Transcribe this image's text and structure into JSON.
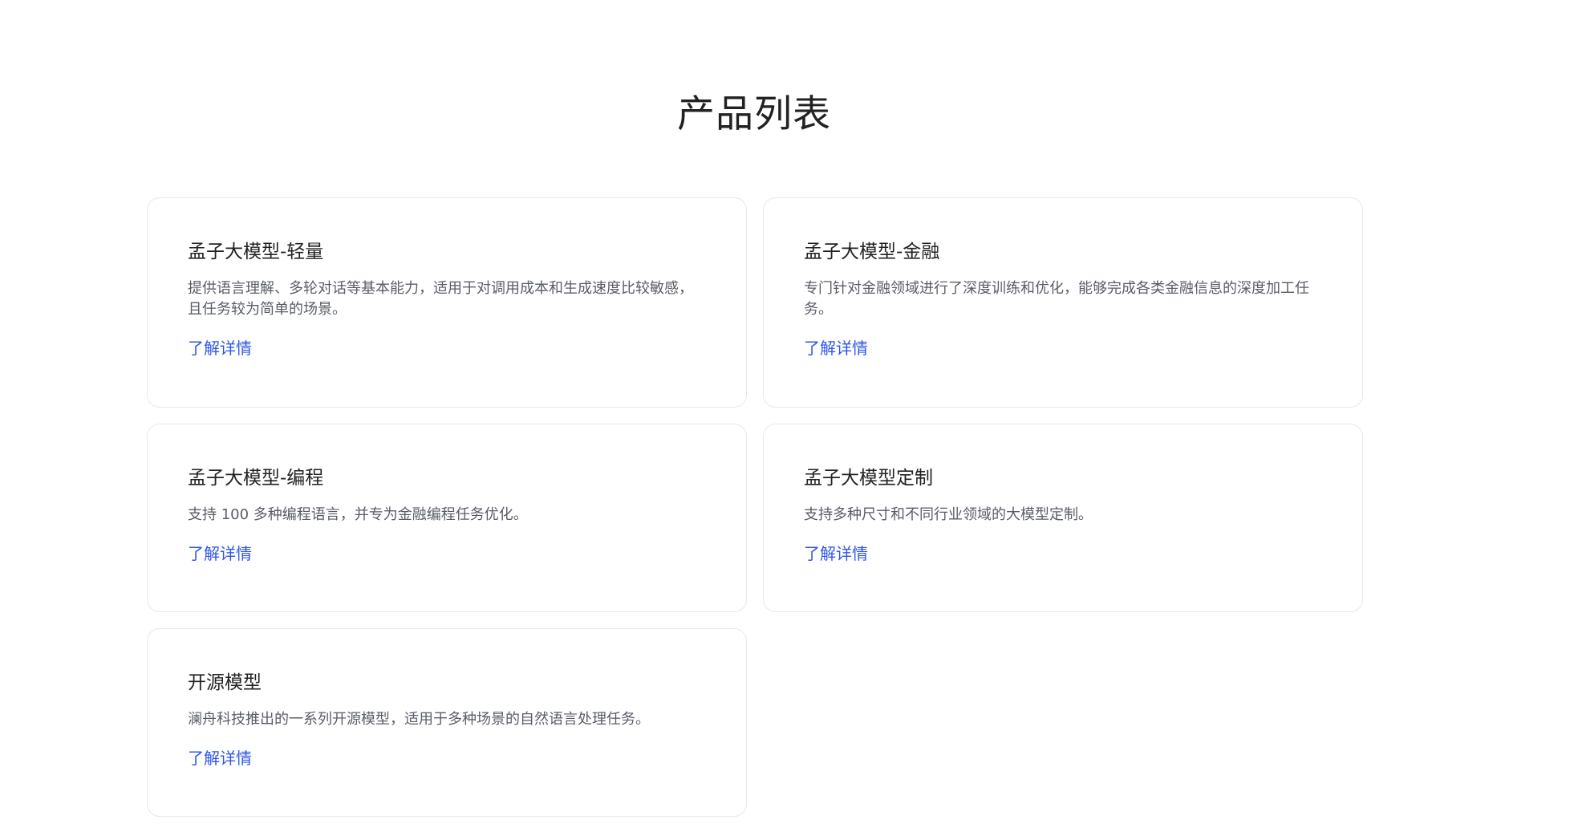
{
  "page": {
    "title": "产品列表"
  },
  "products": [
    {
      "title": "孟子大模型-轻量",
      "description": "提供语言理解、多轮对话等基本能力，适用于对调用成本和生成速度比较敏感，且任务较为简单的场景。",
      "link_label": "了解详情"
    },
    {
      "title": "孟子大模型-金融",
      "description": "专门针对金融领域进行了深度训练和优化，能够完成各类金融信息的深度加工任务。",
      "link_label": "了解详情"
    },
    {
      "title": "孟子大模型-编程",
      "description": "支持 100 多种编程语言，并专为金融编程任务优化。",
      "link_label": "了解详情"
    },
    {
      "title": "孟子大模型定制",
      "description": "支持多种尺寸和不同行业领域的大模型定制。",
      "link_label": "了解详情"
    },
    {
      "title": "开源模型",
      "description": "澜舟科技推出的一系列开源模型，适用于多种场景的自然语言处理任务。",
      "link_label": "了解详情"
    }
  ],
  "colors": {
    "link": "#2f57e6",
    "border": "#e6e8ec",
    "description": "#595d66"
  }
}
